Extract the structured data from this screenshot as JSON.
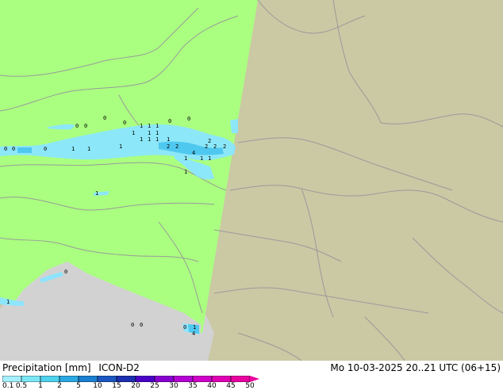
{
  "footer": {
    "label": "Precipitation [mm]",
    "model": "ICON-D2",
    "datetime": "Mo 10-03-2025 20..21 UTC (06+15)"
  },
  "legend": {
    "ticks": [
      "0.1",
      "0.5",
      "1",
      "2",
      "5",
      "10",
      "15",
      "20",
      "25",
      "30",
      "35",
      "40",
      "45",
      "50"
    ],
    "colors": [
      "#a5f0ff",
      "#7ce6f5",
      "#4fd2ee",
      "#2aa8e2",
      "#1c7fd0",
      "#1c56c0",
      "#1c2fb0",
      "#4b00c8",
      "#8800d0",
      "#b400d4",
      "#d000c8",
      "#e000b4",
      "#ea00a0"
    ]
  },
  "map": {
    "domain_color": "#aaff80",
    "outside_color": "#cbc8a4",
    "sea_color": "#d2d2d2",
    "precip_color": "#8be6ff",
    "precip_strong_color": "#4fc8f0",
    "values": [
      "0",
      "0",
      "0",
      "0",
      "0",
      "0",
      "0",
      "0",
      "0",
      "1",
      "1",
      "1",
      "1",
      "1",
      "1",
      "1",
      "1",
      "1",
      "1",
      "1",
      "1",
      "1",
      "1",
      "1",
      "1",
      "1",
      "1",
      "2",
      "2",
      "2",
      "2",
      "2",
      "2",
      "4",
      "4",
      "1",
      "0",
      "0",
      "0",
      "0",
      "1"
    ]
  }
}
